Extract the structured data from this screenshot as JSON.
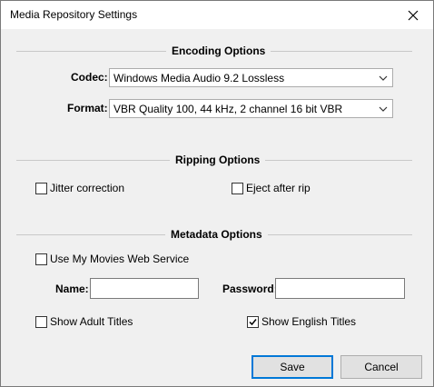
{
  "window": {
    "title": "Media Repository Settings"
  },
  "icons": {
    "close": "close-icon",
    "dropdown": "chevron-down-icon",
    "check": "checkmark-icon"
  },
  "encoding": {
    "heading": "Encoding Options",
    "codec_label": "Codec:",
    "codec_value": "Windows Media Audio 9.2 Lossless",
    "format_label": "Format:",
    "format_value": "VBR Quality 100, 44 kHz, 2 channel 16 bit VBR"
  },
  "ripping": {
    "heading": "Ripping Options",
    "jitter_label": "Jitter correction",
    "jitter_checked": false,
    "eject_label": "Eject after rip",
    "eject_checked": false
  },
  "metadata": {
    "heading": "Metadata Options",
    "use_service_label": "Use My Movies Web Service",
    "use_service_checked": false,
    "name_label": "Name:",
    "name_value": "",
    "password_label": "Password:",
    "password_value": "",
    "adult_label": "Show Adult Titles",
    "adult_checked": false,
    "english_label": "Show English Titles",
    "english_checked": true
  },
  "buttons": {
    "save": "Save",
    "cancel": "Cancel"
  }
}
